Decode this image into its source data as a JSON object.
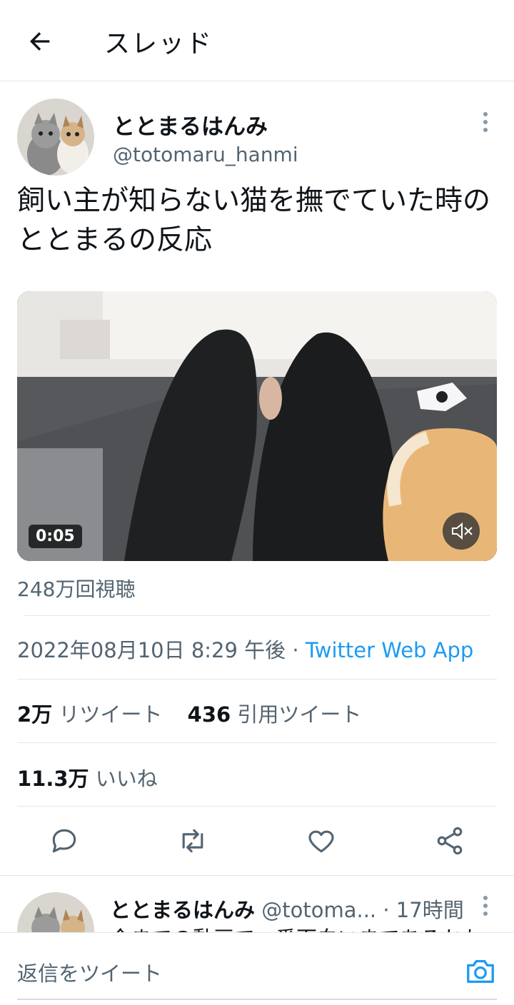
{
  "header": {
    "title": "スレッド"
  },
  "tweet": {
    "author_name": "ととまるはんみ",
    "author_handle": "@totomaru_hanmi",
    "text": "飼い主が知らない猫を撫でていた時のととまるの反応",
    "video": {
      "duration": "0:05",
      "muted": true
    },
    "views": "248万回視聴",
    "datetime": "2022年08月10日 8:29 午後",
    "separator": " · ",
    "source_app": "Twitter Web App",
    "retweets": {
      "count": "2万",
      "label": "リツイート"
    },
    "quotes": {
      "count": "436",
      "label": "引用ツイート"
    },
    "likes": {
      "count": "11.3万",
      "label": "いいね"
    }
  },
  "actions": [
    "reply-icon",
    "retweet-icon",
    "like-icon",
    "share-icon"
  ],
  "reply_tweet": {
    "author_name": "ととまるはんみ",
    "author_handle": "@totoma...",
    "time": "· 17時間",
    "text_partial": "今までの動画で一番面白いまであるかも"
  },
  "composer": {
    "placeholder": "返信をツイート"
  },
  "colors": {
    "accent": "#1d9bf0",
    "secondary_text": "#536471",
    "divider": "#e1e8ed"
  }
}
